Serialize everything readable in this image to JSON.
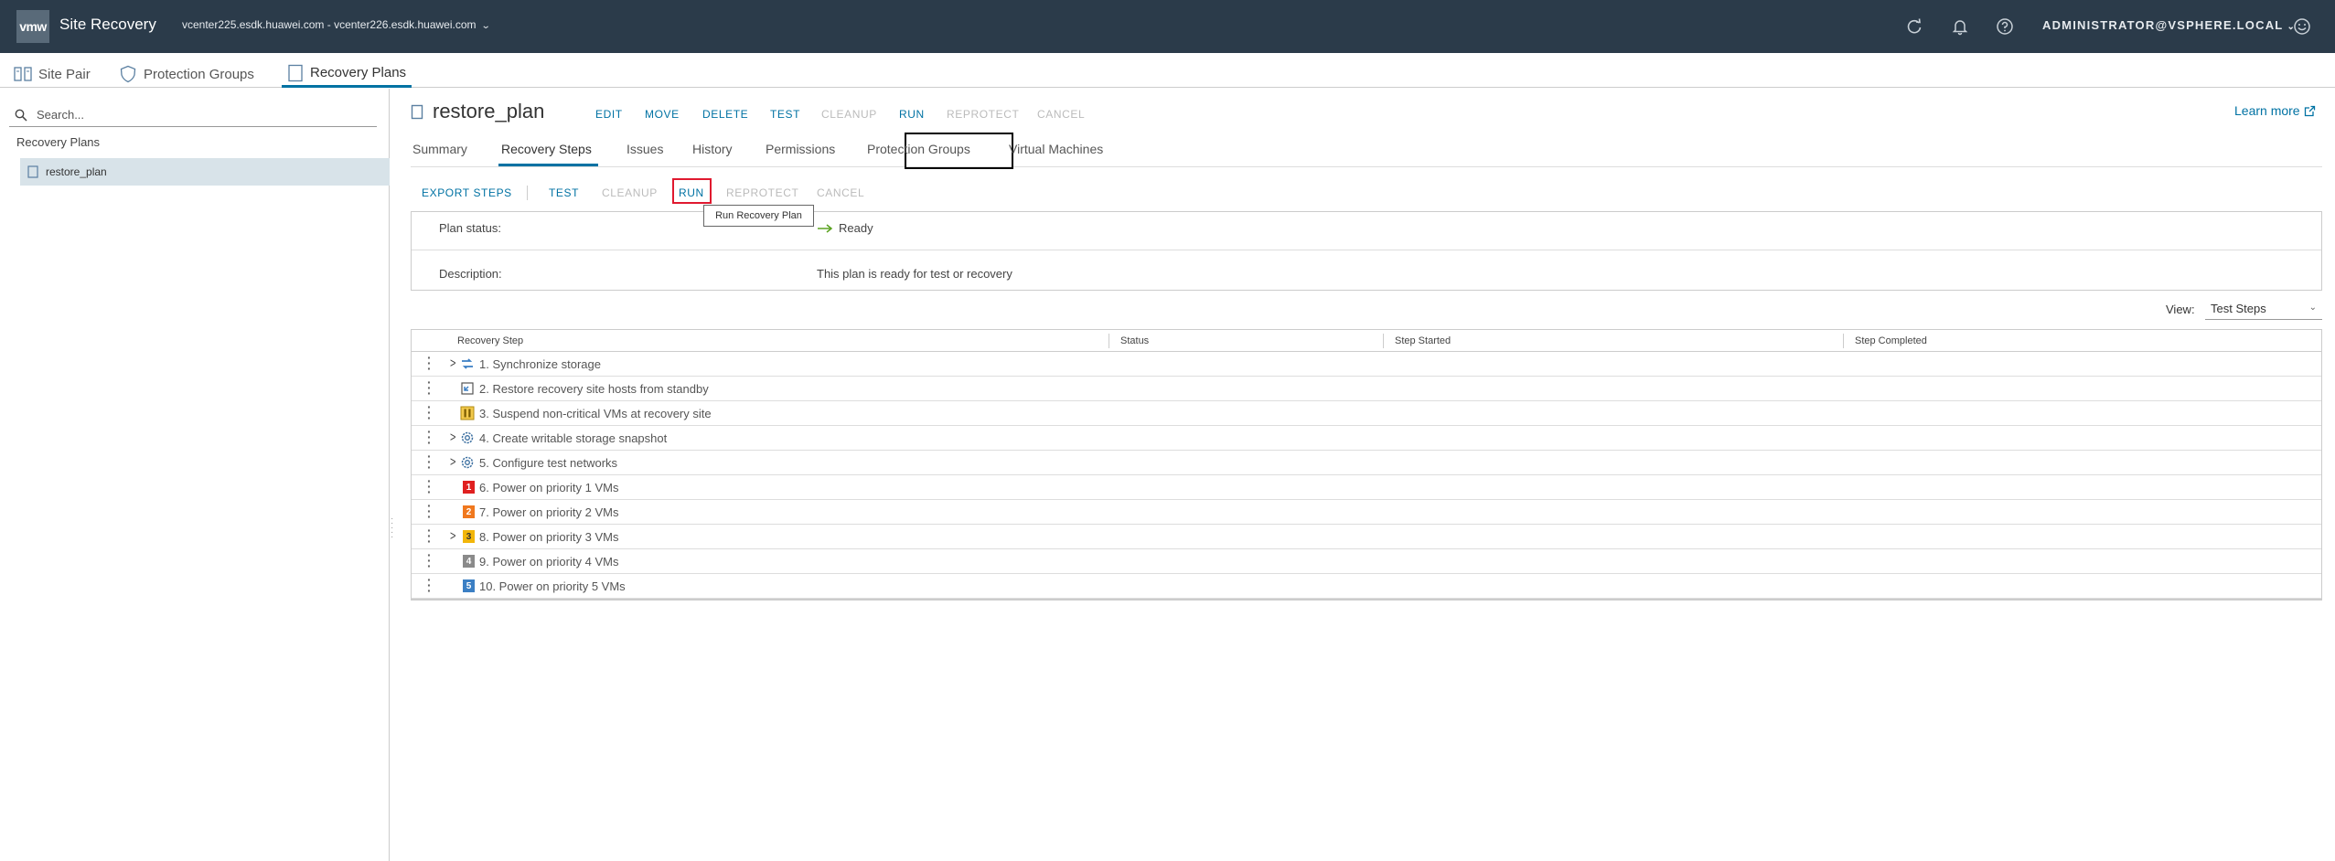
{
  "header": {
    "logo": "vmw",
    "app_title": "Site Recovery",
    "site_pair": "vcenter225.esdk.huawei.com - vcenter226.esdk.huawei.com",
    "user": "Administrator@VSPHERE.LOCAL"
  },
  "main_tabs": [
    {
      "label": "Site Pair",
      "icon": "site-pair-icon"
    },
    {
      "label": "Protection Groups",
      "icon": "shield-icon"
    },
    {
      "label": "Recovery Plans",
      "icon": "document-icon",
      "active": true
    }
  ],
  "sidebar": {
    "search_placeholder": "Search...",
    "heading": "Recovery Plans",
    "items": [
      {
        "label": "restore_plan",
        "selected": true
      }
    ]
  },
  "plan": {
    "name": "restore_plan",
    "actions": [
      {
        "label": "EDIT",
        "enabled": true
      },
      {
        "label": "MOVE",
        "enabled": true
      },
      {
        "label": "DELETE",
        "enabled": true
      },
      {
        "label": "TEST",
        "enabled": true
      },
      {
        "label": "CLEANUP",
        "enabled": false
      },
      {
        "label": "RUN",
        "enabled": true
      },
      {
        "label": "REPROTECT",
        "enabled": false
      },
      {
        "label": "CANCEL",
        "enabled": false
      }
    ],
    "learn_more": "Learn more"
  },
  "sub_tabs": [
    {
      "label": "Summary"
    },
    {
      "label": "Recovery Steps",
      "active": true
    },
    {
      "label": "Issues"
    },
    {
      "label": "History"
    },
    {
      "label": "Permissions"
    },
    {
      "label": "Protection Groups"
    },
    {
      "label": "Virtual Machines"
    }
  ],
  "toolbar": {
    "export": "EXPORT STEPS",
    "items": [
      {
        "label": "TEST",
        "enabled": true
      },
      {
        "label": "CLEANUP",
        "enabled": false
      },
      {
        "label": "RUN",
        "enabled": true
      },
      {
        "label": "REPROTECT",
        "enabled": false
      },
      {
        "label": "CANCEL",
        "enabled": false
      }
    ],
    "tooltip": "Run Recovery Plan"
  },
  "status_panel": {
    "plan_status_label": "Plan status:",
    "plan_status_value": "Ready",
    "description_label": "Description:",
    "description_value": "This plan is ready for test or recovery"
  },
  "view": {
    "label": "View:",
    "selected": "Test Steps"
  },
  "grid": {
    "columns": [
      "Recovery Step",
      "Status",
      "Step Started",
      "Step Completed"
    ],
    "rows": [
      {
        "step": "1. Synchronize storage",
        "expandable": true,
        "icon": "sync-icon"
      },
      {
        "step": "2. Restore recovery site hosts from standby",
        "expandable": false,
        "icon": "host-restore-icon"
      },
      {
        "step": "3. Suspend non-critical VMs at recovery site",
        "expandable": false,
        "icon": "suspend-icon"
      },
      {
        "step": "4. Create writable storage snapshot",
        "expandable": true,
        "icon": "gear-icon"
      },
      {
        "step": "5. Configure test networks",
        "expandable": true,
        "icon": "gear-icon"
      },
      {
        "step": "6. Power on priority 1 VMs",
        "expandable": false,
        "icon": "priority-1-icon",
        "badge": "1",
        "badge_color": "#e02020"
      },
      {
        "step": "7. Power on priority 2 VMs",
        "expandable": false,
        "icon": "priority-2-icon",
        "badge": "2",
        "badge_color": "#f0781e"
      },
      {
        "step": "8. Power on priority 3 VMs",
        "expandable": true,
        "icon": "priority-3-icon",
        "badge": "3",
        "badge_color": "#f2b60a"
      },
      {
        "step": "9. Power on priority 4 VMs",
        "expandable": false,
        "icon": "priority-4-icon",
        "badge": "4",
        "badge_color": "#8a8a8a"
      },
      {
        "step": "10. Power on priority 5 VMs",
        "expandable": false,
        "icon": "priority-5-icon",
        "badge": "5",
        "badge_color": "#3b7fc4"
      }
    ]
  },
  "colors": {
    "header_bg": "#2b3b4a",
    "accent": "#0072a3",
    "highlight_box": "#e0192f",
    "selected_row": "#d8e3e9"
  }
}
